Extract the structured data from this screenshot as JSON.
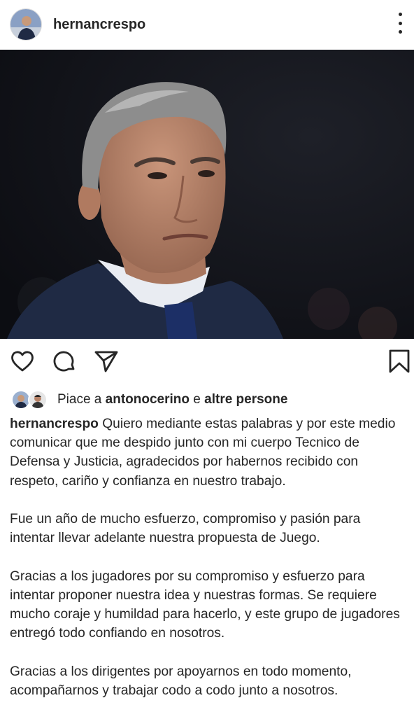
{
  "header": {
    "username": "hernancrespo"
  },
  "actions": {
    "like_icon": "heart-icon",
    "comment_icon": "comment-icon",
    "share_icon": "paper-plane-icon",
    "save_icon": "bookmark-icon"
  },
  "likes": {
    "prefix": "Piace a",
    "user": "antonocerino",
    "joiner": "e",
    "others": "altre persone"
  },
  "caption": {
    "username": "hernancrespo",
    "paragraphs": [
      "Quiero mediante estas palabras y por este medio comunicar que me despido junto con mi cuerpo Tecnico de Defensa y Justicia, agradecidos por  habernos recibido con respeto, cariño y confianza en nuestro trabajo.",
      "Fue un año de mucho esfuerzo, compromiso y pasión para intentar llevar adelante nuestra propuesta de Juego.",
      "Gracias  a los jugadores por su compromiso y esfuerzo para intentar proponer nuestra idea y nuestras formas. Se requiere mucho coraje y humildad para hacerlo, y este grupo de jugadores entregó todo confiando en nosotros.",
      "Gracias a los dirigentes por apoyarnos en todo momento, acompañarnos y trabajar codo a codo junto a nosotros."
    ]
  },
  "colors": {
    "text": "#262626",
    "background": "#ffffff",
    "photo_background": "#15161d",
    "suit": "#1f2a44",
    "tie": "#1c2f66"
  }
}
